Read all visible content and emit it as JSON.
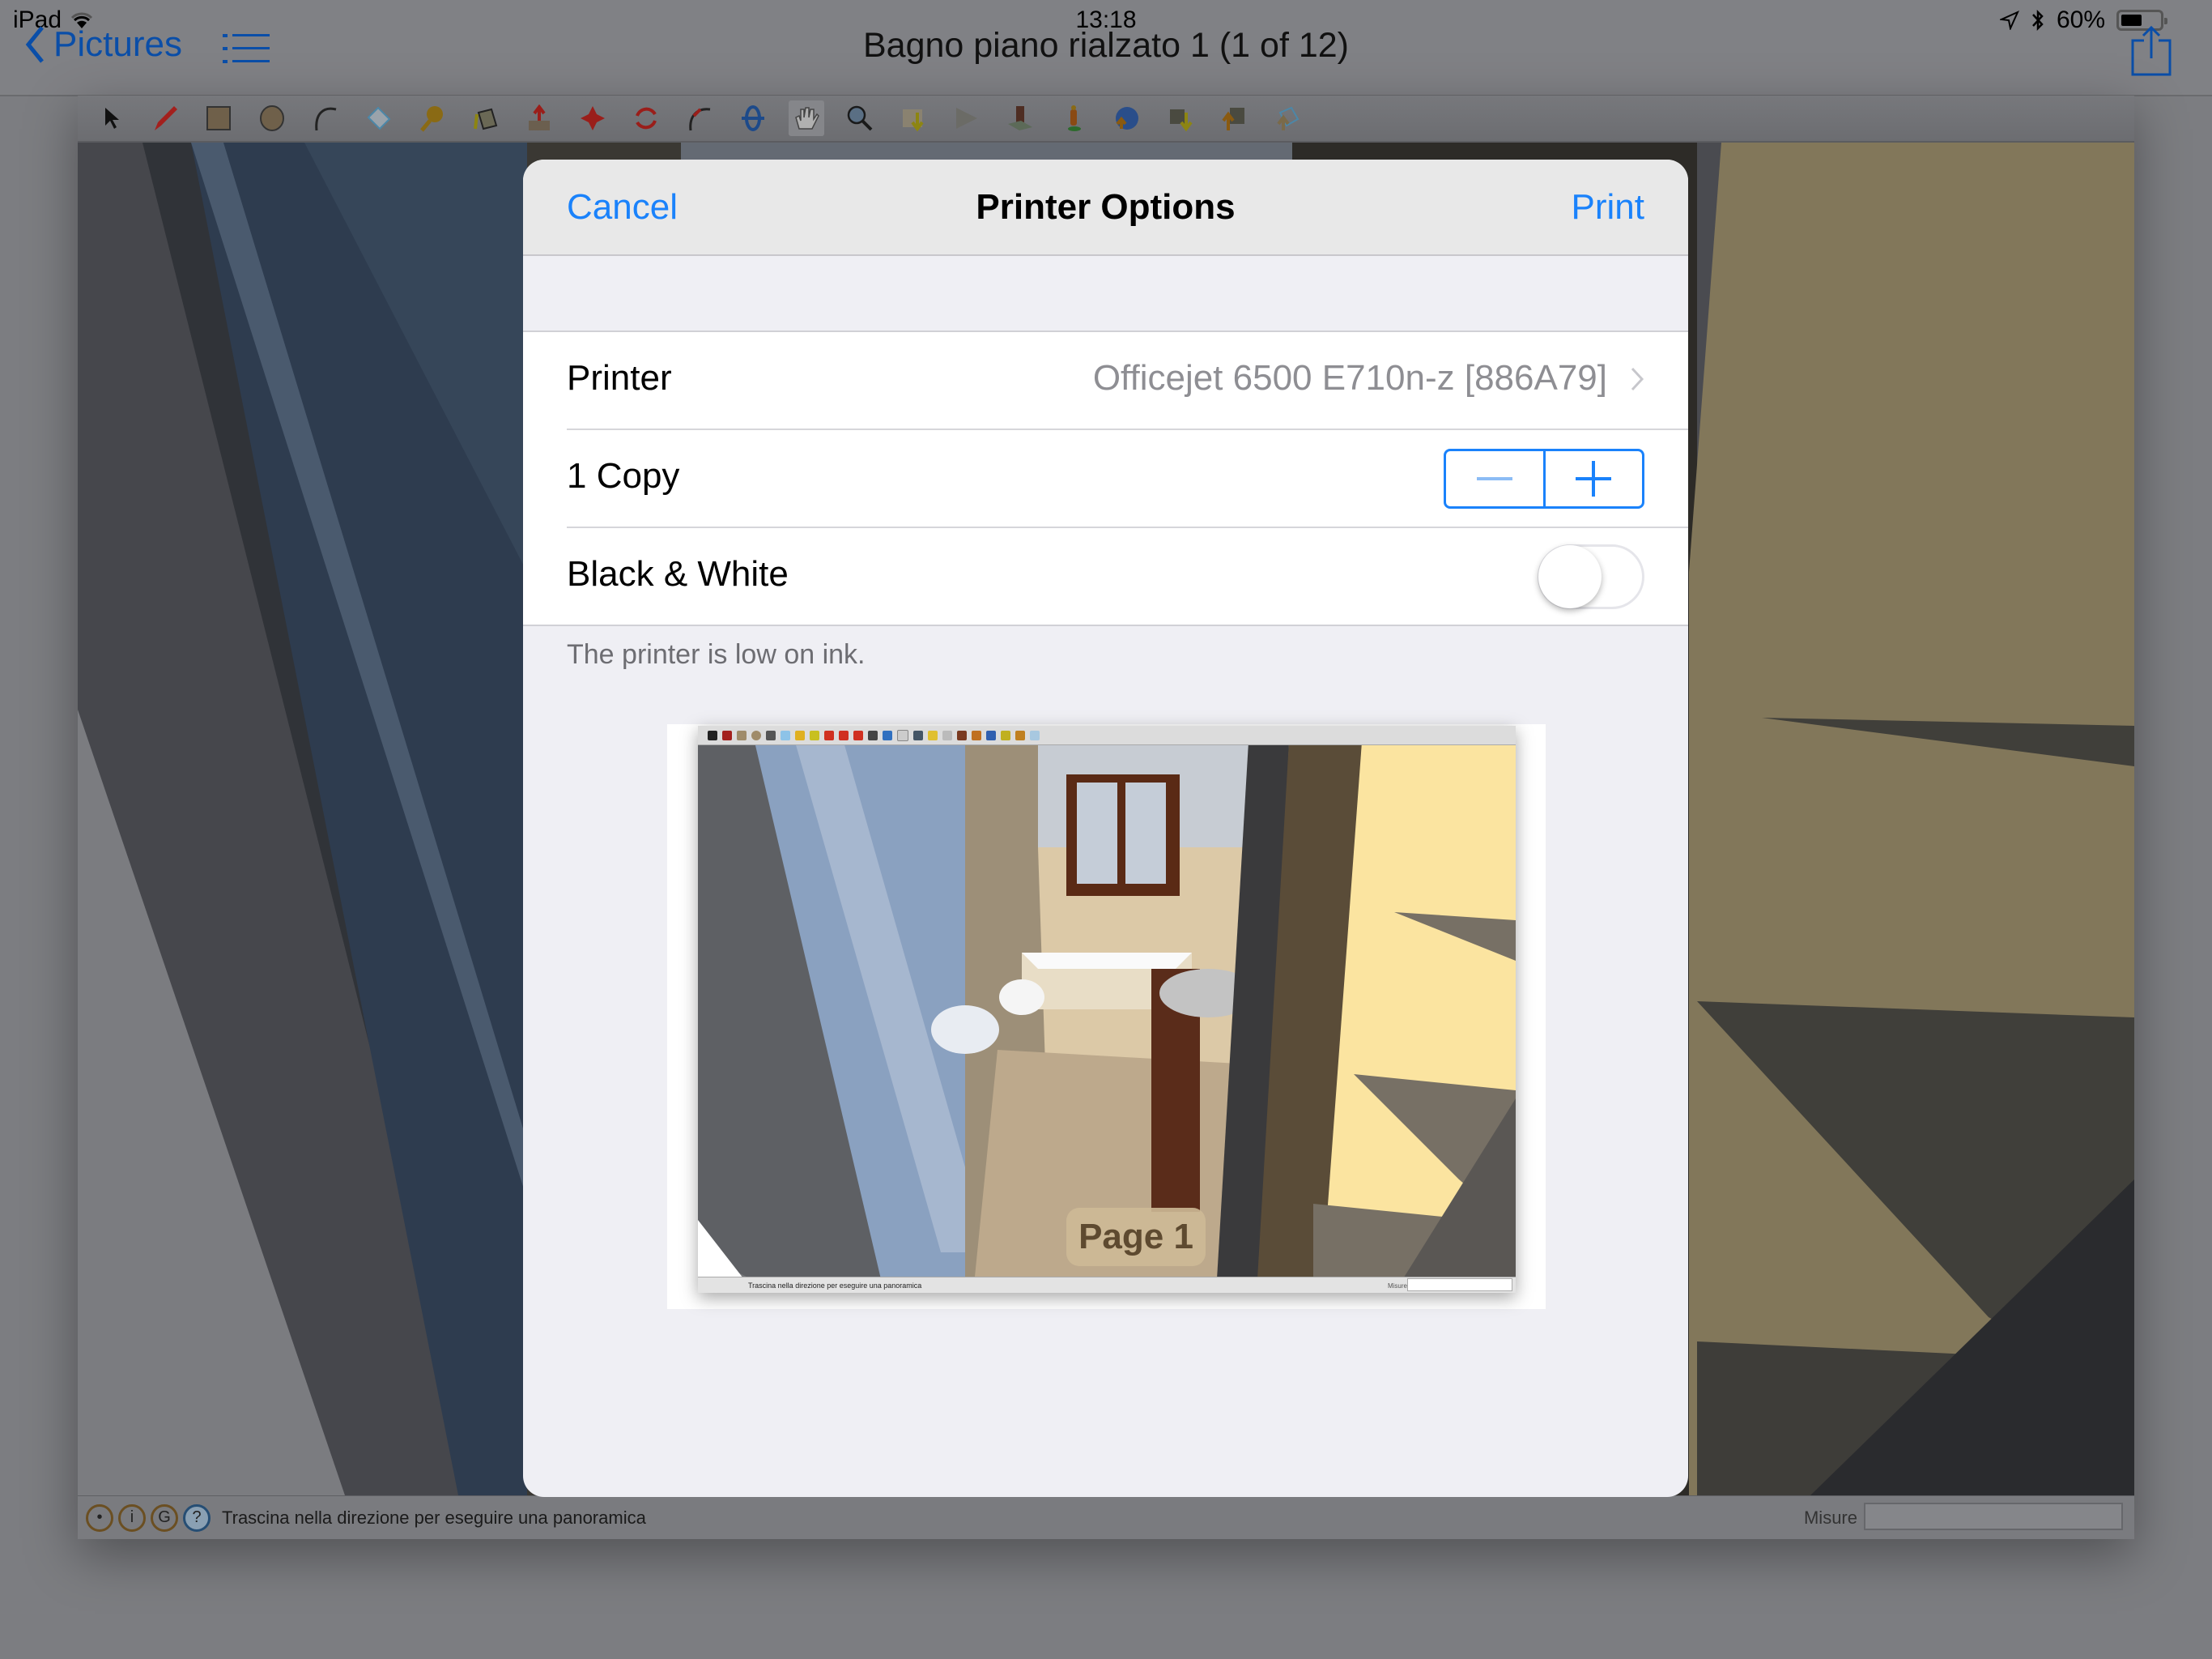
{
  "status_bar": {
    "device": "iPad",
    "time": "13:18",
    "battery_percent": "60%",
    "battery_level": 0.6,
    "icons": [
      "wifi-icon",
      "location-icon",
      "bluetooth-icon",
      "battery-icon"
    ]
  },
  "nav": {
    "back_label": "Pictures",
    "title": "Bagno piano rialzato 1 (1 of 12)",
    "list_icon": "list-icon",
    "share_icon": "share-icon"
  },
  "toolbar": {
    "tools": [
      "select",
      "pencil",
      "rectangle",
      "circle",
      "arc",
      "eraser",
      "tape-measure",
      "paint-bucket",
      "push-pull",
      "move",
      "rotate",
      "follow-me",
      "orbit",
      "pan",
      "zoom",
      "get-models",
      "share-model",
      "components",
      "position-camera",
      "google-earth-export",
      "component-download",
      "component-upload",
      "model-upload"
    ],
    "selected_tool": "pan"
  },
  "app_status": {
    "message": "Trascina nella direzione per eseguire una panoramica",
    "measure_label": "Misure",
    "measure_value": ""
  },
  "dialog": {
    "title": "Printer Options",
    "cancel_label": "Cancel",
    "print_label": "Print",
    "printer_label": "Printer",
    "printer_value": "Officejet 6500 E710n-z [886A79]",
    "copies_label": "1 Copy",
    "copies": 1,
    "bw_label": "Black & White",
    "bw_enabled": false,
    "footnote": "The printer is low on ink.",
    "preview": {
      "page_label": "Page 1",
      "status_text": "Trascina nella direzione per eseguire una panoramica",
      "measure_label": "Misure"
    }
  },
  "colors": {
    "accent": "#1a82fb",
    "nav_tint": "#0a4ea8",
    "dialog_bg": "#efeff4",
    "header_bg": "#e8e8e8"
  }
}
